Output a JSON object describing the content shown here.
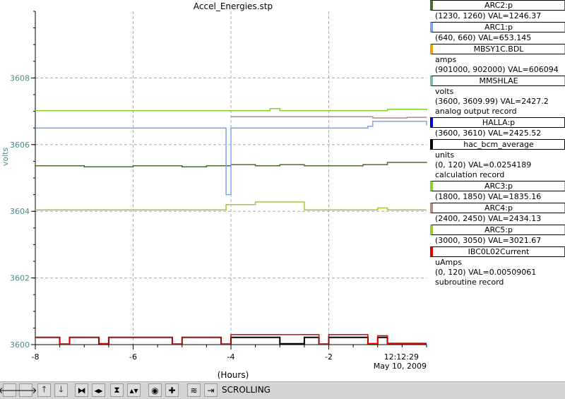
{
  "chart_data": {
    "type": "line",
    "title": "Accel_Energies.stp",
    "ylabel": "volts",
    "xlabel": "(Hours)",
    "xlim": [
      -8,
      0
    ],
    "ylim": [
      3600,
      3610
    ],
    "x_ticks": [
      "-8",
      "-6",
      "-4",
      "-2"
    ],
    "y_ticks": [
      "3600",
      "3602",
      "3604",
      "3606",
      "3608"
    ],
    "time_label": "12:12:29",
    "date_label": "May 10, 2009",
    "grid": true,
    "legend_position": "right",
    "series": [
      {
        "name": "ARC2:p",
        "color": "#4a6a2e",
        "x": [
          -8,
          -7.5,
          -7,
          -6.5,
          -6,
          -5.5,
          -5,
          -4.5,
          -4,
          -3.5,
          -3,
          -2.5,
          -2,
          -1.5,
          -1.3,
          -1.1,
          -0.8,
          -0.4,
          0
        ],
        "y": [
          1246.1,
          1246.1,
          1246.0,
          1246.0,
          1246.1,
          1246.1,
          1246.0,
          1246.1,
          1246.2,
          1246.1,
          1246.2,
          1246.1,
          1246.1,
          1246.1,
          1246.2,
          1246.2,
          1246.4,
          1246.4,
          1246.37
        ]
      },
      {
        "name": "ARC1:p",
        "color": "#7fa3ea",
        "x": [
          -8,
          -7.5,
          -7,
          -6.5,
          -6,
          -5.5,
          -5,
          -4.5,
          -4.1,
          -4,
          -3.5,
          -3,
          -2.5,
          -2,
          -1.5,
          -1.2,
          -1.1,
          -0.8,
          -0.4,
          0
        ],
        "y": [
          653.0,
          653.0,
          653.0,
          653.0,
          653.0,
          653.0,
          653.0,
          653.0,
          649.0,
          653.0,
          653.0,
          653.0,
          653.0,
          653.0,
          653.0,
          653.1,
          653.4,
          653.4,
          653.4,
          653.145
        ]
      },
      {
        "name": "MBSY1C.BDL",
        "color": "#f5a000",
        "unit": "amps",
        "x": [],
        "y": []
      },
      {
        "name": "MMSHLAE",
        "color": "#7fb8a8",
        "unit": "volts",
        "info": "analog output record",
        "x": [],
        "y": []
      },
      {
        "name": "HALLA:p",
        "color": "#0000cc",
        "x": [],
        "y": []
      },
      {
        "name": "hac_bcm_average",
        "color": "#000000",
        "unit": "units",
        "info": "calculation record",
        "x": [
          -8,
          -7.7,
          -7.5,
          -7.3,
          -7.0,
          -6.7,
          -6.5,
          -6.0,
          -5.5,
          -5.2,
          -5.0,
          -4.5,
          -4.2,
          -4.0,
          -3.5,
          -3.0,
          -2.5,
          -2.2,
          -2.0,
          -1.5,
          -1.2,
          -1.0,
          -0.8,
          -0.4,
          0
        ],
        "y": [
          2.6,
          2.6,
          0.2,
          2.6,
          2.6,
          0.3,
          2.6,
          2.6,
          2.6,
          0.2,
          2.6,
          2.6,
          0.2,
          2.6,
          2.6,
          0.3,
          2.6,
          0.2,
          2.6,
          2.6,
          0.3,
          2.6,
          0.4,
          0.4,
          0.4
        ]
      },
      {
        "name": "ARC3:p",
        "color": "#7fd32e",
        "x": [
          -8,
          -7.5,
          -7,
          -6.5,
          -6,
          -5.5,
          -5,
          -4.5,
          -4,
          -3.3,
          -3.2,
          -3.0,
          -2.5,
          -2,
          -1.5,
          -1.1,
          -0.8,
          -0.4,
          0
        ],
        "y": [
          1835.1,
          1835.1,
          1835.1,
          1835.1,
          1835.1,
          1835.1,
          1835.1,
          1835.1,
          1835.1,
          1835.1,
          1835.4,
          1835.1,
          1835.1,
          1835.1,
          1835.1,
          1835.1,
          1835.3,
          1835.3,
          1835.16
        ]
      },
      {
        "name": "ARC4:p",
        "color": "#b08a86",
        "x": [
          -4.0,
          -3.5,
          -3.0,
          -2.5,
          -2.0,
          -1.5,
          -1.2,
          -1.1,
          -0.8,
          -0.4,
          0
        ],
        "y": [
          2434.2,
          2434.2,
          2434.2,
          2434.2,
          2434.2,
          2434.2,
          2434.2,
          2434.0,
          2434.0,
          2434.1,
          2434.13
        ]
      },
      {
        "name": "ARC5:p",
        "color": "#9ec838",
        "x": [
          -8,
          -7,
          -6,
          -5,
          -4.3,
          -4.1,
          -3.9,
          -3.6,
          -3.5,
          -3.3,
          -2.8,
          -2.5,
          -2.2,
          -2.0,
          -1.5,
          -1.1,
          -1.0,
          -0.8,
          -0.4,
          0
        ],
        "y": [
          3020.2,
          3020.2,
          3020.2,
          3020.2,
          3020.2,
          3021.0,
          3021.0,
          3021.0,
          3021.4,
          3021.4,
          3021.4,
          3020.2,
          3020.2,
          3020.2,
          3020.2,
          3020.2,
          3020.5,
          3020.2,
          3020.2,
          3020.2
        ]
      },
      {
        "name": "IBC0L02Current",
        "color": "#e00000",
        "unit": "uAmps",
        "info": "subroutine record",
        "x": [
          -8,
          -7.7,
          -7.5,
          -7.3,
          -7.0,
          -6.7,
          -6.5,
          -6.0,
          -5.5,
          -5.2,
          -5.0,
          -4.5,
          -4.2,
          -4.0,
          -3.5,
          -3.0,
          -2.5,
          -2.2,
          -2.0,
          -1.5,
          -1.2,
          -1.0,
          -0.8,
          -0.4,
          0
        ],
        "y": [
          2.6,
          2.6,
          0.2,
          2.6,
          2.6,
          0.3,
          2.6,
          2.6,
          2.6,
          0.2,
          2.6,
          2.6,
          0.2,
          3.6,
          3.6,
          3.6,
          3.6,
          0.2,
          3.6,
          3.6,
          0.3,
          3.2,
          0.4,
          0.4,
          0.4
        ]
      }
    ]
  },
  "legend": [
    {
      "name": "ARC2:p",
      "color": "#4a6a2e",
      "lines": [
        "(1230, 1260) VAL=1246.37"
      ]
    },
    {
      "name": "ARC1:p",
      "color": "#7fa3ea",
      "lines": [
        "(640, 660) VAL=653.145"
      ]
    },
    {
      "name": "MBSY1C.BDL",
      "color": "#f5a000",
      "lines": [
        "amps",
        "(901000, 902000) VAL=606094"
      ]
    },
    {
      "name": "MMSHLAE",
      "color": "#7fb8a8",
      "lines": [
        "volts",
        "(3600, 3609.99) VAL=2427.2",
        "analog output record"
      ]
    },
    {
      "name": "HALLA:p",
      "color": "#0000cc",
      "lines": [
        "(3600, 3610) VAL=2425.52"
      ]
    },
    {
      "name": "hac_bcm_average",
      "color": "#000000",
      "lines": [
        "units",
        "(0, 120) VAL=0.0254189",
        "calculation record"
      ]
    },
    {
      "name": "ARC3:p",
      "color": "#7fd32e",
      "lines": [
        "(1800, 1850) VAL=1835.16"
      ]
    },
    {
      "name": "ARC4:p",
      "color": "#b08a86",
      "lines": [
        "(2400, 2450) VAL=2434.13"
      ]
    },
    {
      "name": "ARC5:p",
      "color": "#9ec838",
      "lines": [
        "(3000, 3050) VAL=3021.67"
      ]
    },
    {
      "name": "IBC0L02Current",
      "color": "#e00000",
      "lines": [
        "uAmps",
        "(0, 120) VAL=0.00509061",
        "subroutine record"
      ]
    }
  ],
  "ranges": {
    "ARC2:p": [
      1230,
      1260
    ],
    "ARC1:p": [
      640,
      660
    ],
    "hac_bcm_average": [
      0,
      120
    ],
    "ARC3:p": [
      1800,
      1850
    ],
    "ARC4:p": [
      2400,
      2450
    ],
    "ARC5:p": [
      3000,
      3050
    ],
    "IBC0L02Current": [
      0,
      120
    ]
  },
  "toolbar": {
    "buttons": [
      {
        "icon": "arrow-left-icon",
        "glyph": "🡐"
      },
      {
        "icon": "arrow-right-icon",
        "glyph": "🡒"
      },
      {
        "icon": "arrow-up-icon",
        "glyph": "🡑"
      },
      {
        "icon": "arrow-down-icon",
        "glyph": "🡓"
      },
      {
        "icon": "zoom-in-horizontal-icon",
        "glyph": "⧓"
      },
      {
        "icon": "zoom-out-horizontal-icon",
        "glyph": "◂▸"
      },
      {
        "icon": "zoom-in-vertical-icon",
        "glyph": "⧗"
      },
      {
        "icon": "zoom-out-vertical-icon",
        "glyph": "▴▾"
      },
      {
        "icon": "record-icon",
        "glyph": "◉"
      },
      {
        "icon": "add-icon",
        "glyph": "✚"
      },
      {
        "icon": "autoscale-icon",
        "glyph": "≋"
      },
      {
        "icon": "jump-to-now-icon",
        "glyph": "⇥"
      }
    ],
    "status": "SCROLLING"
  }
}
